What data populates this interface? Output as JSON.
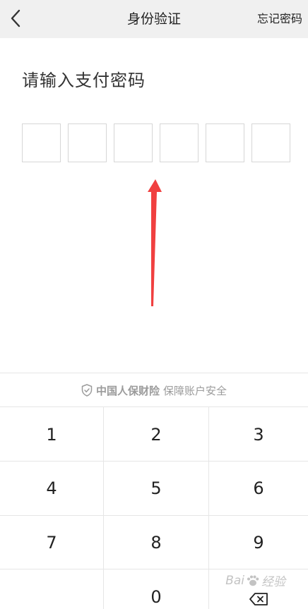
{
  "header": {
    "title": "身份验证",
    "forgot_label": "忘记密码",
    "back_icon": "chevron-left-icon"
  },
  "prompt": {
    "text": "请输入支付密码"
  },
  "pin": {
    "length": 6,
    "entered": 0
  },
  "annotation": {
    "type": "red-arrow",
    "color": "#f04040"
  },
  "security": {
    "icon": "shield-icon",
    "brand": "中国人保财险",
    "text": "保障账户安全"
  },
  "keypad": {
    "keys": [
      "1",
      "2",
      "3",
      "4",
      "5",
      "6",
      "7",
      "8",
      "9",
      "",
      "0",
      "delete"
    ],
    "delete_icon": "backspace-icon"
  },
  "watermark": {
    "text_left": "Bai",
    "text_right": "经验"
  },
  "colors": {
    "header_bg": "#f0f0f0",
    "text": "#222222",
    "muted": "#9b9b9b",
    "border": "#d6d6d6",
    "arrow": "#f04040"
  }
}
